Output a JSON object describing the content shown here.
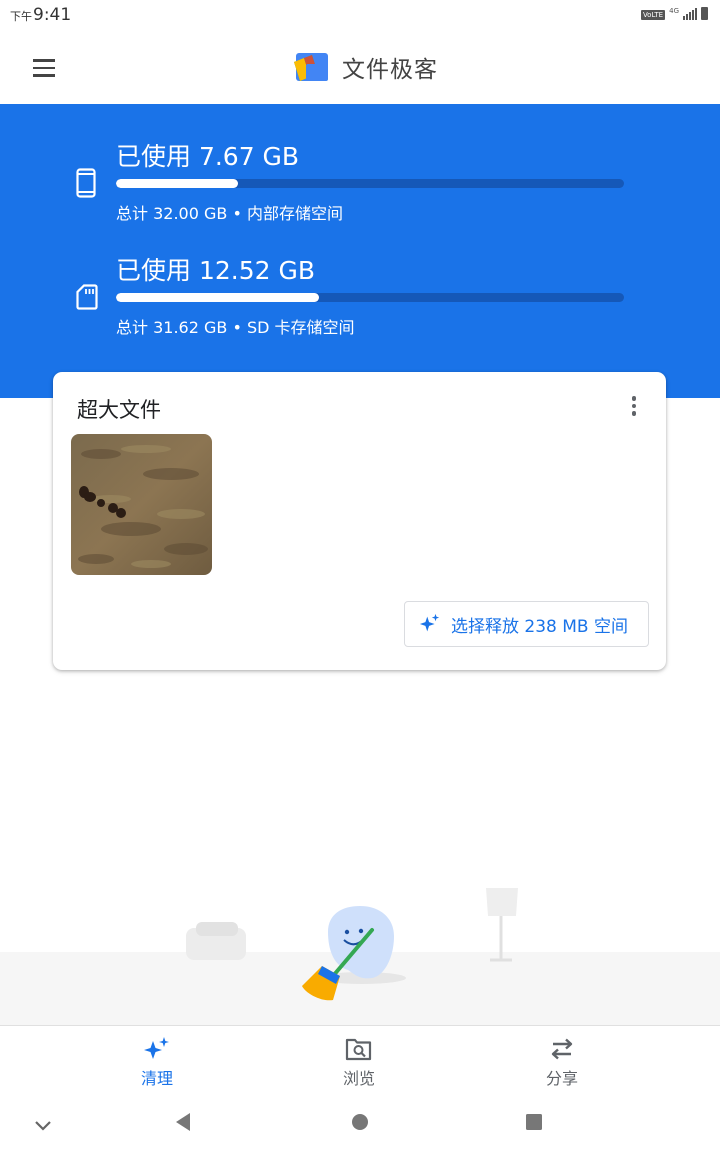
{
  "status_bar": {
    "time_prefix": "下午",
    "time": "9:41",
    "volte": "VoLTE",
    "network": "4G"
  },
  "app_bar": {
    "title": "文件极客",
    "icons": [
      "menu-icon",
      "app-logo"
    ]
  },
  "storage": {
    "internal": {
      "used_text": "已使用 7.67 GB",
      "total_text": "总计 32.00 GB • 内部存储空间",
      "used_fraction": 0.24,
      "icon": "phone-icon"
    },
    "sd": {
      "used_text": "已使用 12.52 GB",
      "total_text": "总计 31.62 GB • SD 卡存储空间",
      "used_fraction": 0.4,
      "icon": "sd-card-icon"
    }
  },
  "large_files_card": {
    "title": "超大文件",
    "free_button_label": "选择释放 238 MB 空间",
    "thumbnail": "image-thumbnail-bison-on-hillside"
  },
  "bottom_nav": {
    "items": [
      {
        "label": "清理",
        "icon": "sparkle-icon",
        "active": true
      },
      {
        "label": "浏览",
        "icon": "browse-icon",
        "active": false
      },
      {
        "label": "分享",
        "icon": "swap-arrows-icon",
        "active": false
      }
    ]
  },
  "colors": {
    "accent": "#1a73e8",
    "bar_track": "#1558b8",
    "inactive_nav": "#5f6368"
  }
}
